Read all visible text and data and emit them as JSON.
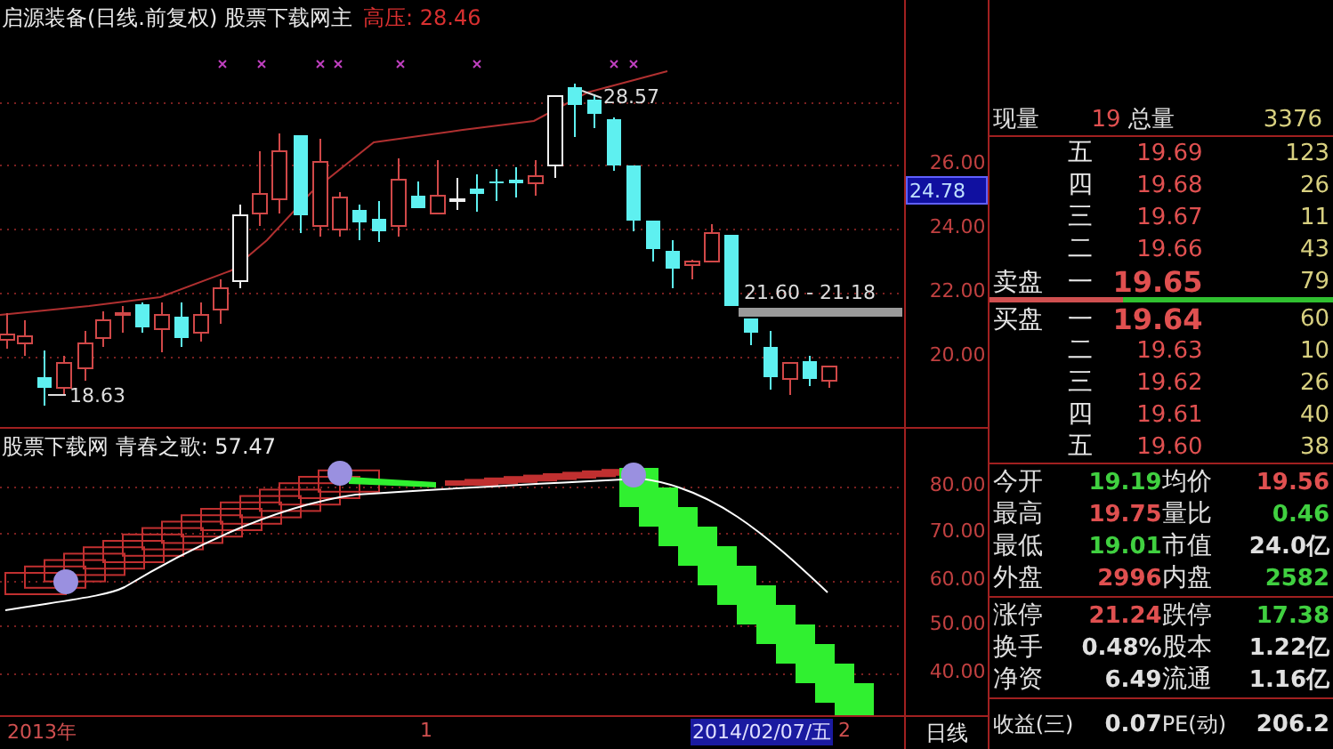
{
  "header": {
    "title": "启源装备(日线.前复权) 股票下载网主",
    "resistance": "高压: 28.46"
  },
  "price_chart": {
    "high_label": "28.57",
    "low_label": "18.63",
    "range_label": "21.60 - 21.18",
    "axis": [
      "26.00",
      "24.00",
      "22.00",
      "20.00"
    ],
    "current_price": "24.78"
  },
  "indicator": {
    "title": "股票下载网 青春之歌: 57.47",
    "axis": [
      "80.00",
      "70.00",
      "60.00",
      "50.00",
      "40.00"
    ]
  },
  "date_axis": [
    {
      "text": "2013年",
      "selected": false
    },
    {
      "text": "1",
      "selected": false
    },
    {
      "text": "2014/02/07/五",
      "selected": true
    },
    {
      "text": "2",
      "selected": false
    }
  ],
  "period": "日线",
  "quote": {
    "summary": [
      {
        "label": "现量",
        "value": "19"
      },
      {
        "label": "总量",
        "value": "3376"
      }
    ],
    "asks": [
      {
        "rank": "五",
        "price": "19.69",
        "volume": "123",
        "best": false
      },
      {
        "rank": "四",
        "price": "19.68",
        "volume": "26",
        "best": false
      },
      {
        "rank": "三",
        "price": "19.67",
        "volume": "11",
        "best": false
      },
      {
        "rank": "二",
        "price": "19.66",
        "volume": "43",
        "best": false
      },
      {
        "side": "卖盘",
        "rank": "一",
        "price": "19.65",
        "volume": "79",
        "best": true
      }
    ],
    "bids": [
      {
        "side": "买盘",
        "rank": "一",
        "price": "19.64",
        "volume": "60",
        "best": true
      },
      {
        "rank": "二",
        "price": "19.63",
        "volume": "10",
        "best": false
      },
      {
        "rank": "三",
        "price": "19.62",
        "volume": "26",
        "best": false
      },
      {
        "rank": "四",
        "price": "19.61",
        "volume": "40",
        "best": false
      },
      {
        "rank": "五",
        "price": "19.60",
        "volume": "38",
        "best": false
      }
    ],
    "stat_groups": [
      [
        [
          {
            "label": "今开",
            "value": "19.19",
            "color": "#40d040"
          },
          {
            "label": "均价",
            "value": "19.56",
            "color": "#e05050"
          }
        ],
        [
          {
            "label": "最高",
            "value": "19.75",
            "color": "#e05050"
          },
          {
            "label": "量比",
            "value": "0.46",
            "color": "#40d040"
          }
        ],
        [
          {
            "label": "最低",
            "value": "19.01",
            "color": "#40d040"
          },
          {
            "label": "市值",
            "value": "24.0亿",
            "color": "#e0e0e0"
          }
        ],
        [
          {
            "label": "外盘",
            "value": "2996",
            "color": "#e05050"
          },
          {
            "label": "内盘",
            "value": "2582",
            "color": "#40d040"
          }
        ]
      ],
      [
        [
          {
            "label": "涨停",
            "value": "21.24",
            "color": "#e05050"
          },
          {
            "label": "跌停",
            "value": "17.38",
            "color": "#40d040"
          }
        ],
        [
          {
            "label": "换手",
            "value": "0.48%",
            "color": "#e0e0e0"
          },
          {
            "label": "股本",
            "value": "1.22亿",
            "color": "#e0e0e0"
          }
        ],
        [
          {
            "label": "净资",
            "value": "6.49",
            "color": "#e0e0e0"
          },
          {
            "label": "流通",
            "value": "1.16亿",
            "color": "#e0e0e0"
          }
        ]
      ],
      [
        [
          {
            "label": "收益(三)",
            "value": "0.07",
            "color": "#e0e0e0"
          },
          {
            "label": "PE(动)",
            "value": "206.2",
            "color": "#e0e0e0"
          }
        ]
      ]
    ]
  }
}
